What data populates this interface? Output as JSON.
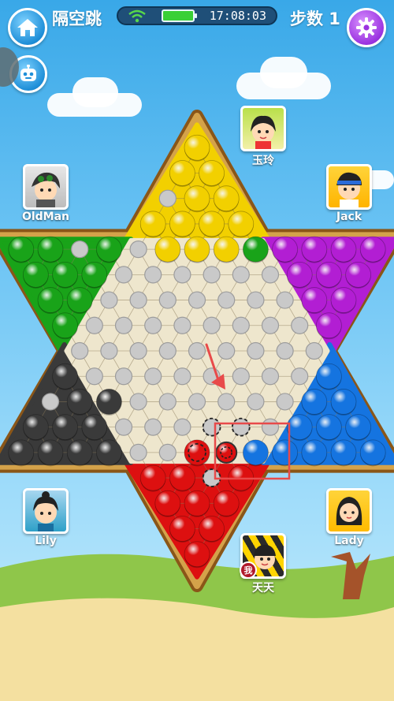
{
  "header": {
    "home_icon": "home-icon",
    "title": "隔空跳",
    "status": {
      "wifi_icon": "wifi-icon",
      "battery_icon": "battery-icon",
      "battery_color": "#39d036",
      "time": "17:08:03"
    },
    "steps_label": "步数 1",
    "settings_icon": "gear-icon"
  },
  "robot_icon": "robot-icon",
  "players": {
    "top": {
      "name": "玉玲",
      "color": "yellow"
    },
    "top_left": {
      "name": "OldMan",
      "color": "green"
    },
    "top_right": {
      "name": "Jack",
      "color": "purple"
    },
    "bottom_left": {
      "name": "Lily",
      "color": "black"
    },
    "bottom_right": {
      "name": "Lady",
      "color": "blue"
    },
    "bottom": {
      "name": "天天",
      "badge": "我",
      "color": "red"
    }
  },
  "colors": {
    "yellow": "#f2d000",
    "green": "#19a319",
    "purple": "#b21ed3",
    "black": "#3a3a3a",
    "blue": "#1574e0",
    "red": "#dd1010",
    "board_frame": "#d4a24a",
    "board_surface": "#eee6cd",
    "highlight": "#e84a4a"
  }
}
